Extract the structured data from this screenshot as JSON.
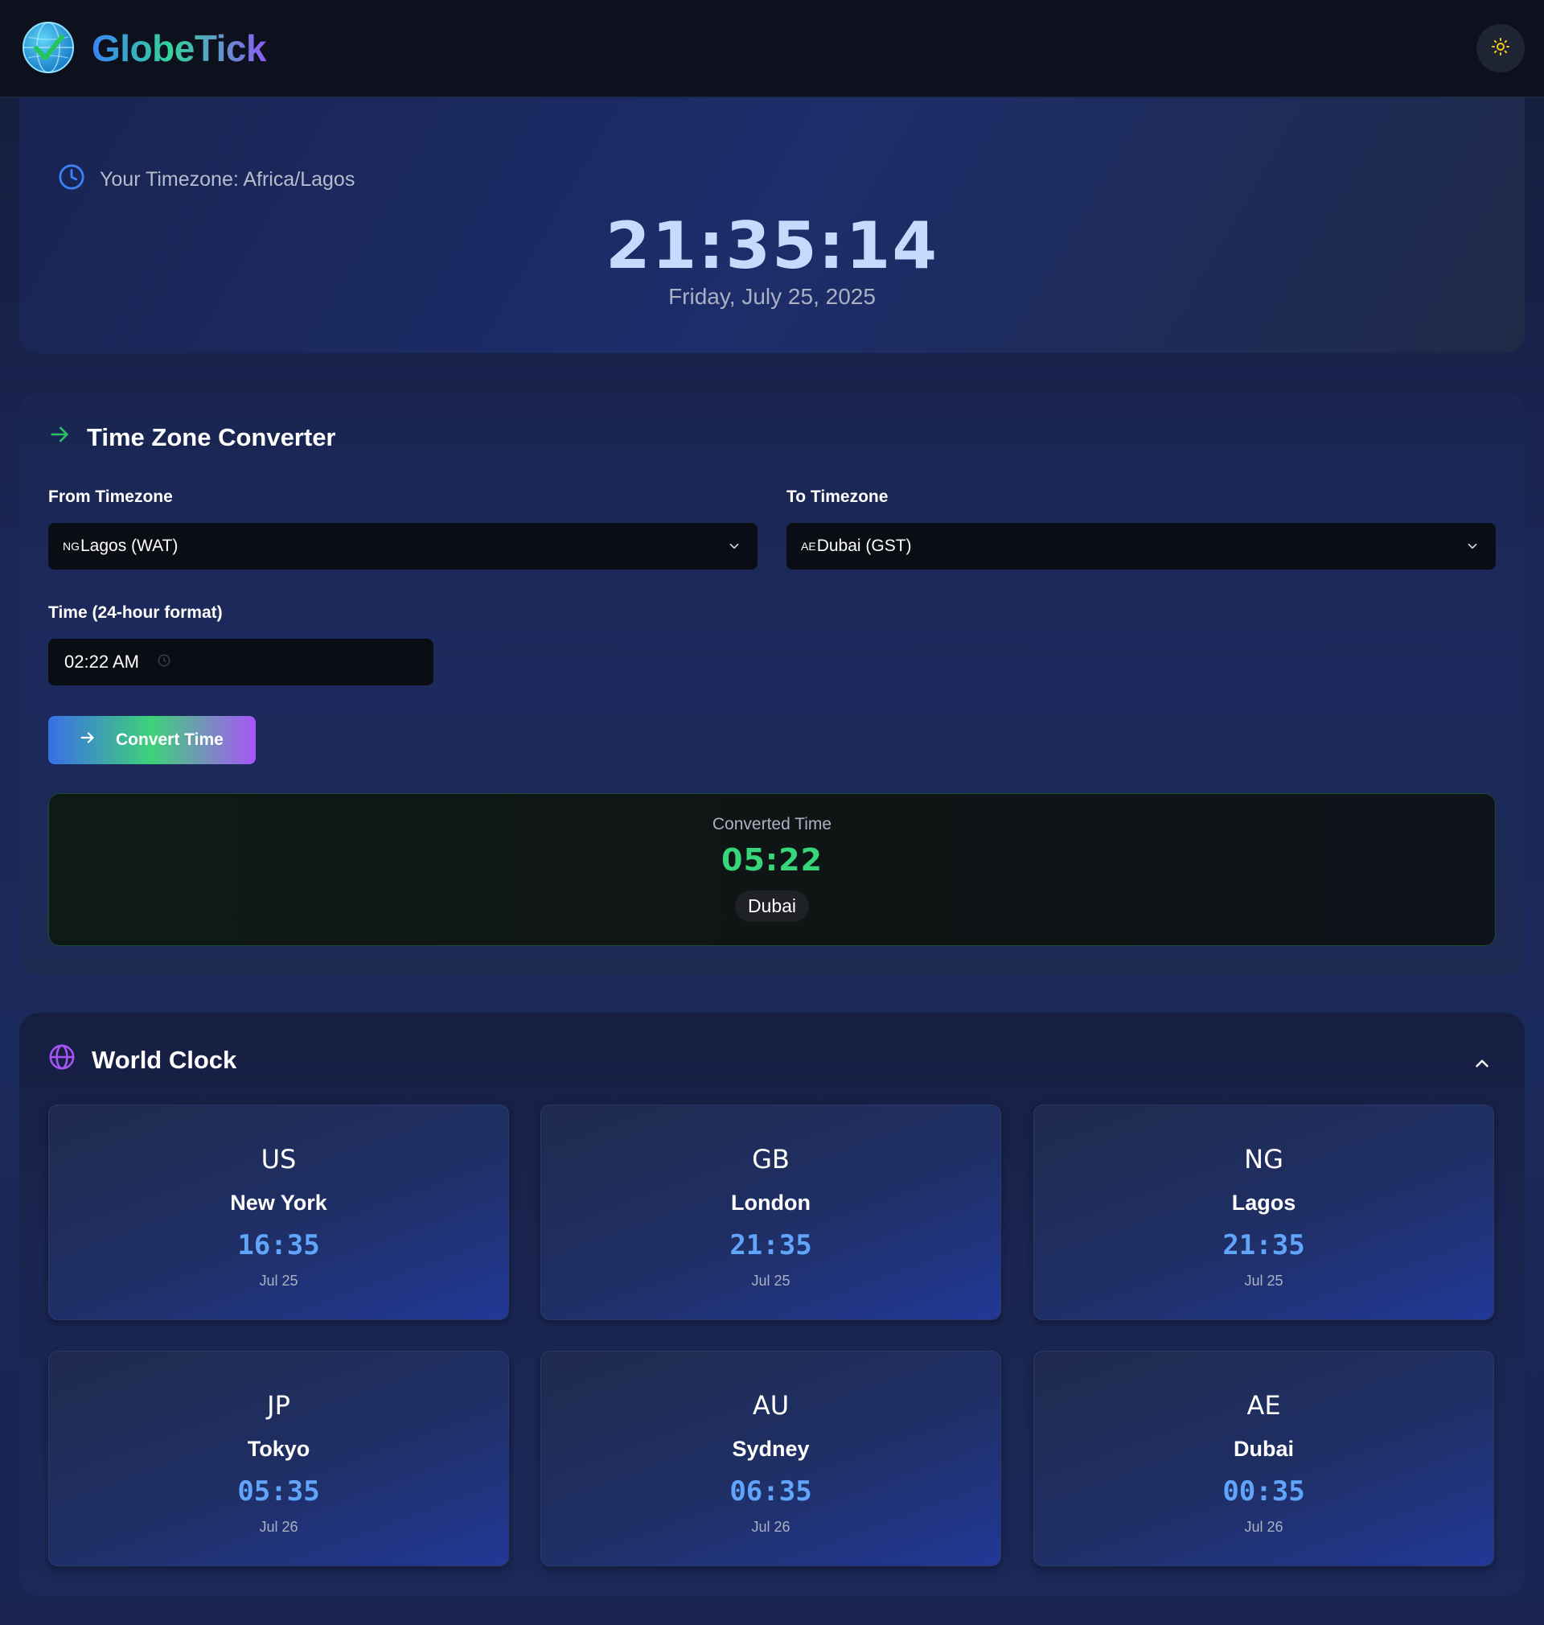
{
  "app": {
    "name": "GlobeTick"
  },
  "header": {
    "theme_icon": "sun-icon"
  },
  "hero": {
    "timezone_label": "Your Timezone: Africa/Lagos",
    "current_time": "21:35:14",
    "current_date": "Friday, July 25, 2025"
  },
  "converter": {
    "title": "Time Zone Converter",
    "from_label": "From Timezone",
    "from_cc": "NG",
    "from_value": "Lagos (WAT)",
    "to_label": "To Timezone",
    "to_cc": "AE",
    "to_value": "Dubai (GST)",
    "time_label": "Time (24-hour format)",
    "time_value": "02:22 AM",
    "convert_label": "Convert Time",
    "result_label": "Converted Time",
    "result_time": "05:22",
    "result_city": "Dubai"
  },
  "world_clock": {
    "title": "World Clock",
    "clocks": [
      {
        "code": "US",
        "city": "New York",
        "time": "16:35",
        "date": "Jul 25"
      },
      {
        "code": "GB",
        "city": "London",
        "time": "21:35",
        "date": "Jul 25"
      },
      {
        "code": "NG",
        "city": "Lagos",
        "time": "21:35",
        "date": "Jul 25"
      },
      {
        "code": "JP",
        "city": "Tokyo",
        "time": "05:35",
        "date": "Jul 26"
      },
      {
        "code": "AU",
        "city": "Sydney",
        "time": "06:35",
        "date": "Jul 26"
      },
      {
        "code": "AE",
        "city": "Dubai",
        "time": "00:35",
        "date": "Jul 26"
      }
    ]
  },
  "colors": {
    "accent_blue": "#3b82f6",
    "accent_green": "#37d67a",
    "accent_purple": "#8b5cf6",
    "clock_time": "#60a5fa"
  }
}
